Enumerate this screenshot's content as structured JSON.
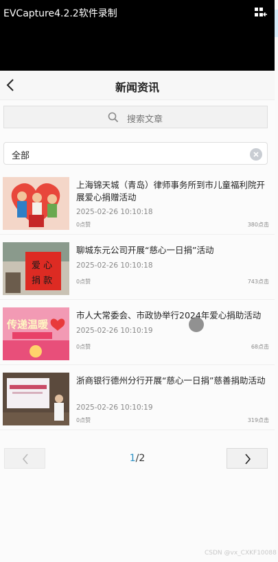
{
  "recorder": {
    "title": "EVCapture4.2.2软件录制",
    "menu_icon": "grid-arrow-icon"
  },
  "header": {
    "title": "新闻资讯",
    "back_icon": "chevron-left-icon"
  },
  "search": {
    "placeholder": "搜索文章",
    "icon": "search-icon"
  },
  "filter": {
    "value": "全部",
    "clear_icon": "close-circle-icon"
  },
  "articles": [
    {
      "title": "上海锦天城（青岛）律师事务所到市儿童福利院开展爱心捐赠活动",
      "date": "2025-02-26 10:10:18",
      "likes": "0点赞",
      "clicks": "380点击"
    },
    {
      "title": "聊城东元公司开展“慈心一日捐”活动",
      "date": "2025-02-26 10:10:18",
      "likes": "0点赞",
      "clicks": "743点击",
      "thumb_text": "爱心捐款"
    },
    {
      "title": "市人大常委会、市政协举行2024年爱心捐助活动",
      "date": "2025-02-26 10:10:19",
      "likes": "0点赞",
      "clicks": "68点击",
      "thumb_text": "传递温暖"
    },
    {
      "title": "浙商银行德州分行开展“慈心一日捐”慈善捐助活动",
      "date": "2025-02-26 10:10:19",
      "likes": "0点赞",
      "clicks": "319点击"
    }
  ],
  "pager": {
    "current": "1",
    "total": "/2",
    "prev_icon": "chevron-left-icon",
    "next_icon": "chevron-right-icon"
  },
  "watermark": "CSDN @vx_CXKF10088",
  "colors": {
    "accent": "#2a8fc4",
    "topbar": "#000000"
  }
}
